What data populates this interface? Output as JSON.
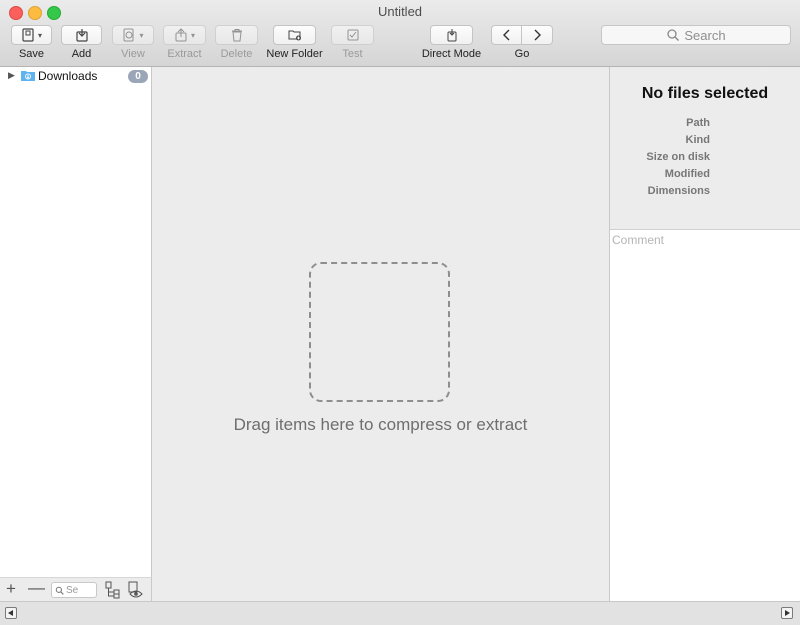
{
  "window": {
    "title": "Untitled"
  },
  "toolbar": {
    "save_label": "Save",
    "add_label": "Add",
    "view_label": "View",
    "extract_label": "Extract",
    "delete_label": "Delete",
    "new_folder_label": "New Folder",
    "test_label": "Test",
    "direct_mode_label": "Direct Mode",
    "go_label": "Go",
    "search_placeholder": "Search",
    "icons": {
      "save": "archive-icon",
      "add": "add-files-icon",
      "view": "quicklook-icon",
      "extract": "extract-icon",
      "delete": "trash-icon",
      "new_folder": "new-folder-icon",
      "test": "checkmark-icon",
      "direct_mode": "direct-mode-icon",
      "back": "chevron-left-icon",
      "forward": "chevron-right-icon",
      "search": "search-icon"
    }
  },
  "sidebar": {
    "items": [
      {
        "label": "Downloads",
        "count": "0",
        "icon": "downloads-folder-icon"
      }
    ],
    "bottom": {
      "add_symbol": "+",
      "remove_symbol": "—",
      "search_placeholder": "Se"
    }
  },
  "drop_area": {
    "hint": "Drag items here to compress or extract"
  },
  "inspector": {
    "title": "No files selected",
    "labels": [
      "Path",
      "Kind",
      "Size on disk",
      "Modified",
      "Dimensions"
    ],
    "comment_placeholder": "Comment"
  },
  "colors": {
    "count_badge": "#9aa6b7",
    "folder_blue": "#5fb3f0",
    "desktop": "#6b3a2e"
  }
}
